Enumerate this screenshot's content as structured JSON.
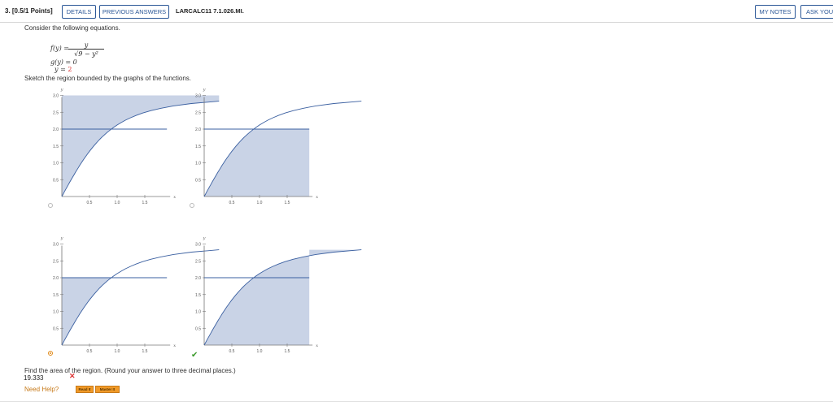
{
  "header": {
    "question_number": "3. [0.5/1 Points]",
    "details_label": "DETAILS",
    "previous_answers_label": "PREVIOUS ANSWERS",
    "problem_code": "LARCALC11 7.1.026.MI.",
    "my_notes_label": "MY NOTES",
    "ask_label": "ASK YOUR"
  },
  "problem": {
    "intro": "Consider the following equations.",
    "f_lhs": "f(y) =",
    "f_numerator": "y",
    "f_denominator": "√9 − y²",
    "g_equation": "g(y) = 0",
    "y_lhs": "y =",
    "y_value": "2",
    "sketch_prompt": "Sketch the region bounded by the graphs of the functions.",
    "find_prompt": "Find the area of the region. (Round your answer to three decimal places.)"
  },
  "graphs": {
    "axis_x_label": "x",
    "axis_y_label": "y",
    "x_ticks": [
      "0.5",
      "1.0",
      "1.5"
    ],
    "y_ticks": [
      "0.5",
      "1.0",
      "1.5",
      "2.0",
      "2.5",
      "3.0"
    ],
    "fill_color": "#c9d3e6",
    "line_color": "#3a5fa0",
    "options": [
      {
        "name": "option-a",
        "selected": false,
        "correct": false
      },
      {
        "name": "option-b",
        "selected": false,
        "correct": false
      },
      {
        "name": "option-c",
        "selected": true,
        "correct": false
      },
      {
        "name": "option-d",
        "selected": false,
        "correct": true
      }
    ]
  },
  "answer": {
    "value": "19.333",
    "status": "incorrect"
  },
  "help": {
    "need_help": "Need Help?",
    "read_it": "Read It",
    "master_it": "Master It"
  }
}
